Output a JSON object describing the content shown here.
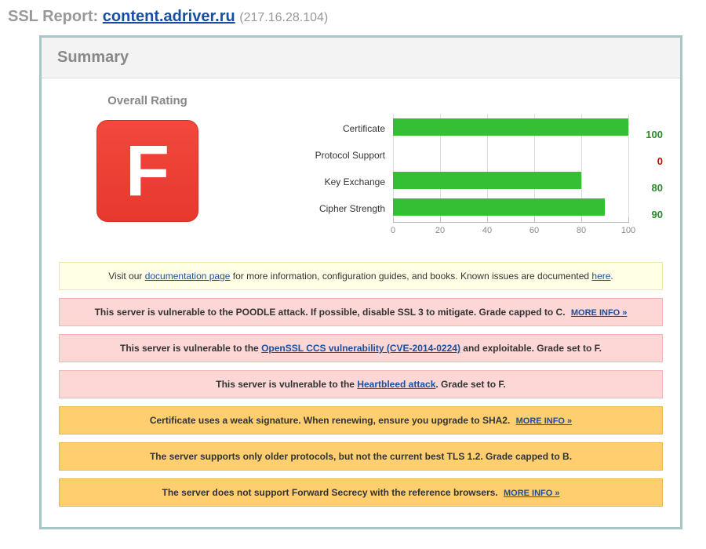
{
  "header": {
    "prefix": "SSL Report: ",
    "hostname": "content.adriver.ru",
    "ip": "(217.16.28.104)"
  },
  "panel": {
    "title": "Summary",
    "rating_label": "Overall Rating",
    "grade": "F"
  },
  "chart_data": {
    "type": "bar",
    "categories": [
      "Certificate",
      "Protocol Support",
      "Key Exchange",
      "Cipher Strength"
    ],
    "values": [
      100,
      0,
      80,
      90
    ],
    "value_colors": [
      "green",
      "red",
      "green",
      "green"
    ],
    "xlim": [
      0,
      100
    ],
    "ticks": [
      0,
      20,
      40,
      60,
      80,
      100
    ],
    "title": "",
    "xlabel": "",
    "ylabel": ""
  },
  "banners": {
    "doc": {
      "pre": "Visit our ",
      "link": "documentation page",
      "post": " for more information, configuration guides, and books. Known issues are documented ",
      "here": "here",
      "dot": "."
    },
    "poodle": {
      "text": "This server is vulnerable to the POODLE attack. If possible, disable SSL 3 to mitigate. Grade capped to C.",
      "more": "MORE INFO »"
    },
    "ccs": {
      "pre": "This server is vulnerable to the ",
      "link": "OpenSSL CCS vulnerability (CVE-2014-0224)",
      "post": " and exploitable. Grade set to F."
    },
    "heartbleed": {
      "pre": "This server is vulnerable to the ",
      "link": "Heartbleed attack",
      "post": ". Grade set to F."
    },
    "sha2": {
      "text": "Certificate uses a weak signature. When renewing, ensure you upgrade to SHA2.",
      "more": "MORE INFO »"
    },
    "tls12": {
      "text": "The server supports only older protocols, but not the current best TLS 1.2. Grade capped to B."
    },
    "fs": {
      "text": "The server does not support Forward Secrecy with the reference browsers.",
      "more": "MORE INFO »"
    }
  }
}
